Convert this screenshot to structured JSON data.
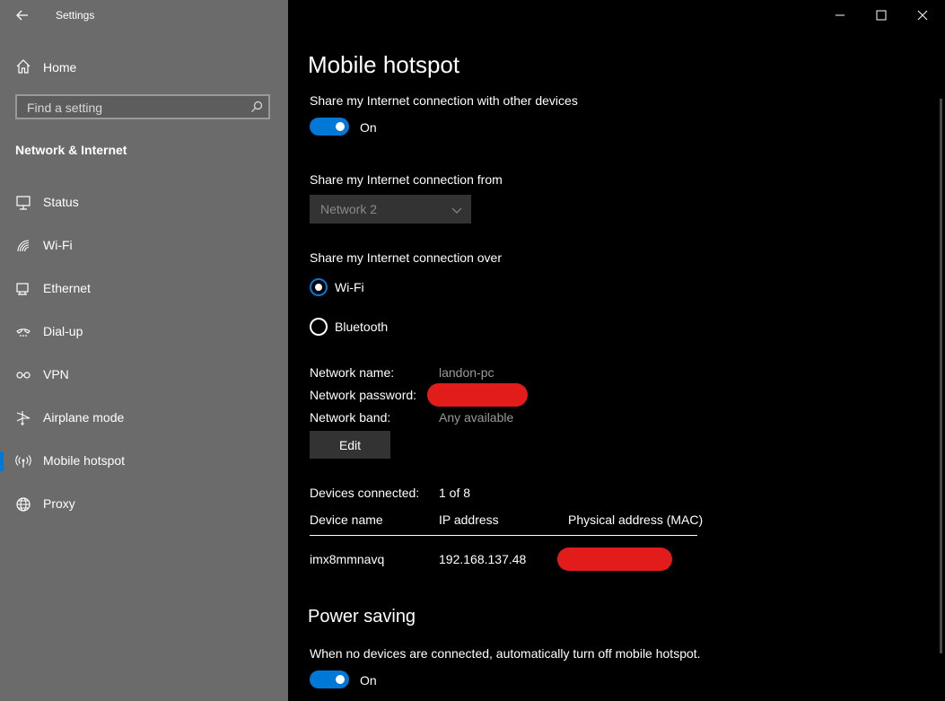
{
  "sidebar": {
    "app_title": "Settings",
    "home_label": "Home",
    "search_placeholder": "Find a setting",
    "section_title": "Network & Internet",
    "items": [
      {
        "label": "Status",
        "icon": "status-icon"
      },
      {
        "label": "Wi-Fi",
        "icon": "wifi-icon"
      },
      {
        "label": "Ethernet",
        "icon": "ethernet-icon"
      },
      {
        "label": "Dial-up",
        "icon": "dialup-icon"
      },
      {
        "label": "VPN",
        "icon": "vpn-icon"
      },
      {
        "label": "Airplane mode",
        "icon": "airplane-icon"
      },
      {
        "label": "Mobile hotspot",
        "icon": "hotspot-icon",
        "selected": true
      },
      {
        "label": "Proxy",
        "icon": "globe-icon"
      }
    ]
  },
  "main": {
    "title": "Mobile hotspot",
    "share_label": "Share my Internet connection with other devices",
    "share_toggle_state": "On",
    "share_from_label": "Share my Internet connection from",
    "share_from_value": "Network 2",
    "share_over_label": "Share my Internet connection over",
    "share_over_options": [
      {
        "label": "Wi-Fi",
        "checked": true
      },
      {
        "label": "Bluetooth",
        "checked": false
      }
    ],
    "network_name_label": "Network name:",
    "network_name_value": "landon-pc",
    "network_password_label": "Network password:",
    "network_band_label": "Network band:",
    "network_band_value": "Any available",
    "edit_label": "Edit",
    "devices_connected_label": "Devices connected:",
    "devices_connected_value": "1 of 8",
    "devices_table": {
      "headers": [
        "Device name",
        "IP address",
        "Physical address (MAC)"
      ],
      "rows": [
        {
          "device_name": "imx8mmnavq",
          "ip_address": "192.168.137.48"
        }
      ]
    },
    "power_saving_title": "Power saving",
    "power_saving_label": "When no devices are connected, automatically turn off mobile hotspot.",
    "power_saving_toggle_state": "On"
  },
  "colors": {
    "sidebar_bg": "#6b6b6b",
    "main_bg": "#000000",
    "accent": "#0078d7",
    "redaction": "#e21b1b"
  }
}
